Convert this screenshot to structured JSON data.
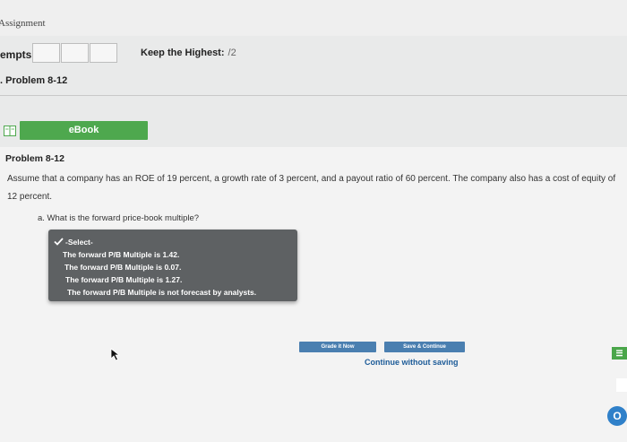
{
  "header": {
    "assignment_link": "Assignment"
  },
  "attempts": {
    "label": "empts:",
    "box_count": 3
  },
  "keep_highest": {
    "label": "Keep the Highest:",
    "score": "/2"
  },
  "problem": {
    "heading": ". Problem 8-12",
    "title": "Problem 8-12",
    "text": "Assume that a company has an ROE of 19 percent, a growth rate of 3 percent, and a payout ratio of 60 percent. The company also has a cost of equity of 12 percent.",
    "question": "a. What is the forward price-book multiple?"
  },
  "ebook": {
    "label": "eBook"
  },
  "dropdown": {
    "selected": "-Select-",
    "options": [
      "-Select-",
      "The forward P/B Multiple is 1.42.",
      "The forward P/B Multiple is 0.07.",
      "The forward P/B Multiple is 1.27.",
      "The forward P/B Multiple is not forecast by analysts."
    ]
  },
  "actions": {
    "grade_label": "Grade it Now",
    "save_label": "Save & Continue",
    "continue_label": "Continue without saving"
  },
  "side": {
    "green_label": "☰",
    "circle_label": "O"
  },
  "colors": {
    "ebook_green": "#4ea84e",
    "action_blue": "#4a7fb0",
    "link_blue": "#1c5b98",
    "dropdown_bg": "#5e6163"
  }
}
